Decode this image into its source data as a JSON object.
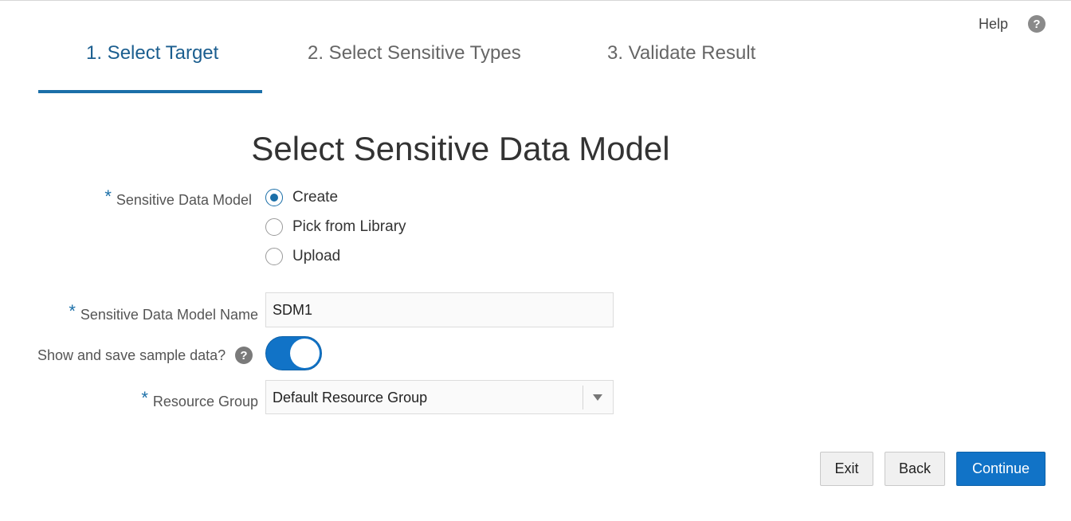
{
  "header": {
    "help_label": "Help",
    "help_icon": "?"
  },
  "wizard": {
    "steps": [
      {
        "label": "1. Select Target",
        "active": true
      },
      {
        "label": "2. Select Sensitive Types",
        "active": false
      },
      {
        "label": "3. Validate Result",
        "active": false
      }
    ]
  },
  "form": {
    "title": "Select Sensitive Data Model",
    "required_marker": "*",
    "sdm": {
      "label": "Sensitive Data Model",
      "options": [
        {
          "label": "Create",
          "selected": true
        },
        {
          "label": "Pick from Library",
          "selected": false
        },
        {
          "label": "Upload",
          "selected": false
        }
      ]
    },
    "name": {
      "label": "Sensitive Data Model Name",
      "value": "SDM1"
    },
    "sample_data": {
      "label": "Show and save sample data?",
      "help_icon": "?",
      "enabled": true
    },
    "resource_group": {
      "label": "Resource Group",
      "value": "Default Resource Group"
    }
  },
  "actions": {
    "exit_label": "Exit",
    "back_label": "Back",
    "continue_label": "Continue"
  },
  "colors": {
    "accent": "#1173c7",
    "active_tab": "#1b5e8f"
  }
}
